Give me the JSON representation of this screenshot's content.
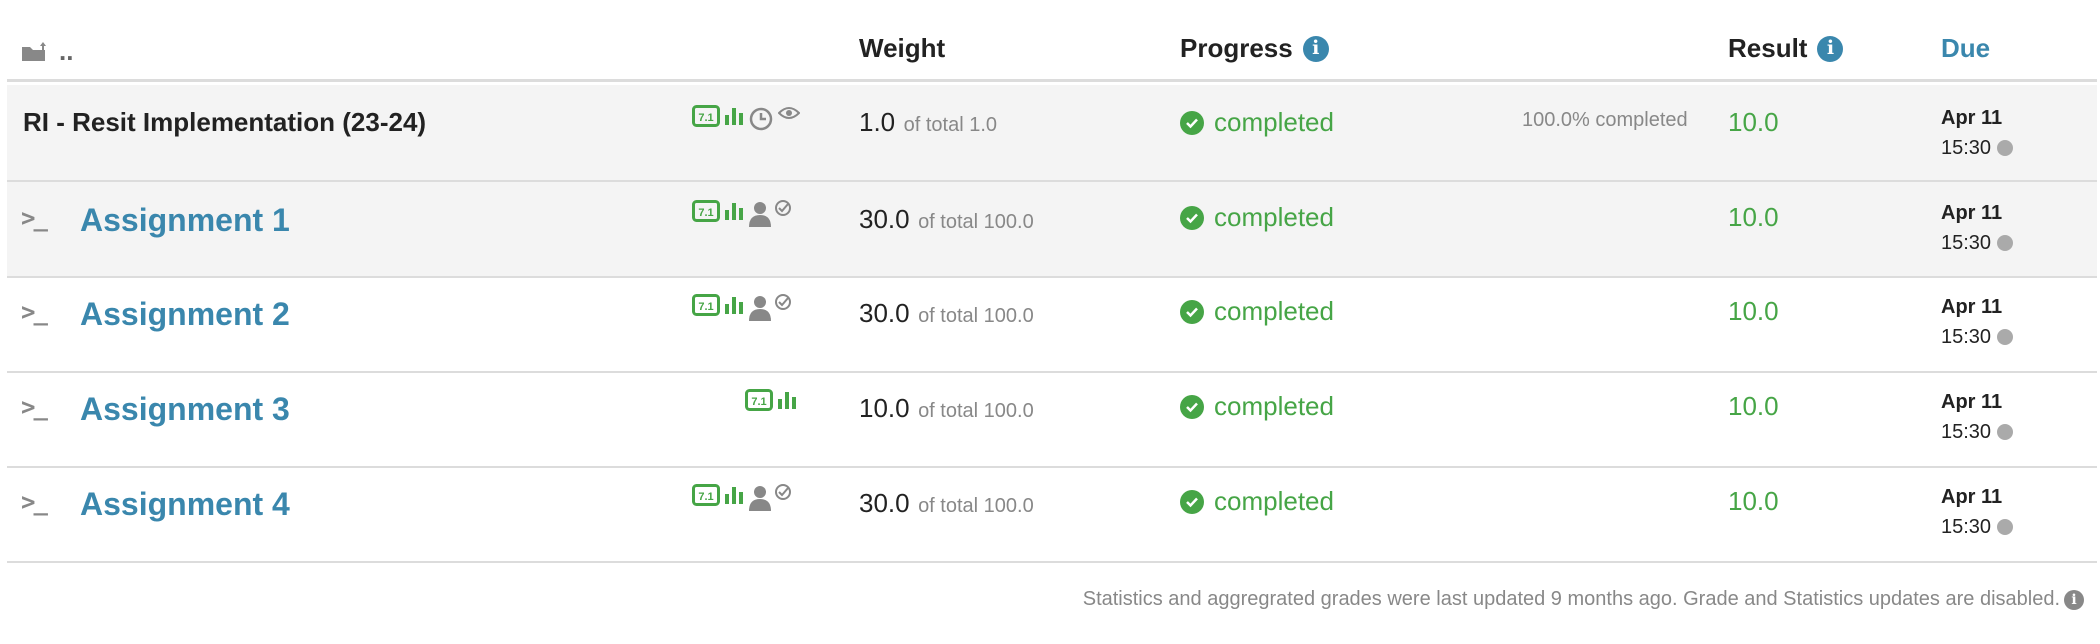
{
  "header": {
    "parent_label": "..",
    "weight": "Weight",
    "progress": "Progress",
    "result": "Result",
    "due": "Due"
  },
  "summary": {
    "title": "RI - Resit Implementation (23-24)",
    "weight_value": "1.0",
    "weight_of": "of total 1.0",
    "progress": "completed",
    "percent": "100.0% completed",
    "result": "10.0",
    "due_date": "Apr 11",
    "due_time": "15:30"
  },
  "assignments": [
    {
      "title": "Assignment 1",
      "weight_value": "30.0",
      "weight_of": "of total 100.0",
      "progress": "completed",
      "result": "10.0",
      "due_date": "Apr 11",
      "due_time": "15:30"
    },
    {
      "title": "Assignment 2",
      "weight_value": "30.0",
      "weight_of": "of total 100.0",
      "progress": "completed",
      "result": "10.0",
      "due_date": "Apr 11",
      "due_time": "15:30"
    },
    {
      "title": "Assignment 3",
      "weight_value": "10.0",
      "weight_of": "of total 100.0",
      "progress": "completed",
      "result": "10.0",
      "due_date": "Apr 11",
      "due_time": "15:30"
    },
    {
      "title": "Assignment 4",
      "weight_value": "30.0",
      "weight_of": "of total 100.0",
      "progress": "completed",
      "result": "10.0",
      "due_date": "Apr 11",
      "due_time": "15:30"
    }
  ],
  "footer": {
    "note": "Statistics and aggregrated grades were last updated 9 months ago. Grade and Statistics updates are disabled."
  },
  "colors": {
    "link": "#3a87ad",
    "success": "#46a546",
    "muted": "#888888"
  }
}
